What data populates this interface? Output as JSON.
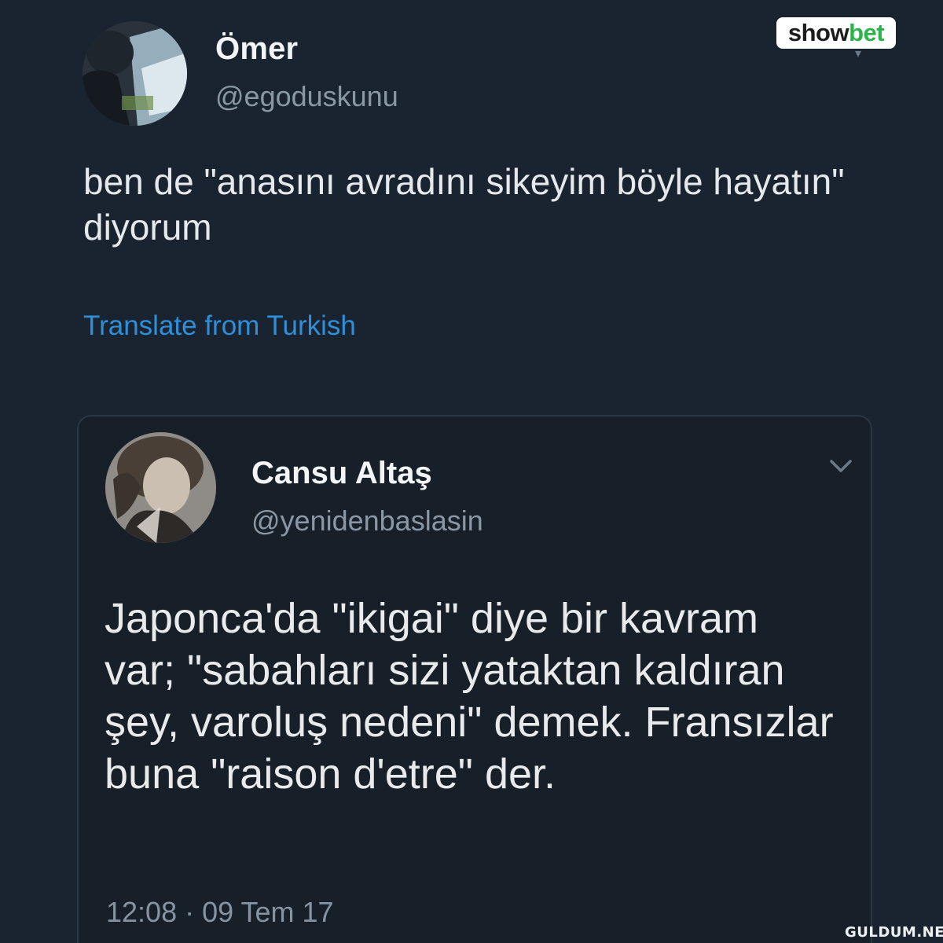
{
  "colors": {
    "background": "#1a2330",
    "link": "#2f8fd8",
    "secondary_text": "#8a98a6",
    "brand_green": "#2cb34a"
  },
  "brand_badge": {
    "part1": "show",
    "part2": "bet"
  },
  "tweet": {
    "author_name": "Ömer",
    "author_handle": "@egoduskunu",
    "text": "ben de \"anasını avradını sikeyim böyle hayatın\" diyorum",
    "translate_label": "Translate from Turkish"
  },
  "quoted_tweet": {
    "author_name": "Cansu Altaş",
    "author_handle": "@yenidenbaslasin",
    "menu_icon": "chevron-down-icon",
    "text": "Japonca'da \"ikigai\" diye bir kavram var; \"sabahları sizi yataktan kaldıran şey, varoluş nedeni\" demek. Fransızlar buna \"raison d'etre\" der.",
    "timestamp": "12:08 · 09 Tem 17"
  },
  "watermark": "GULDUM.NET"
}
